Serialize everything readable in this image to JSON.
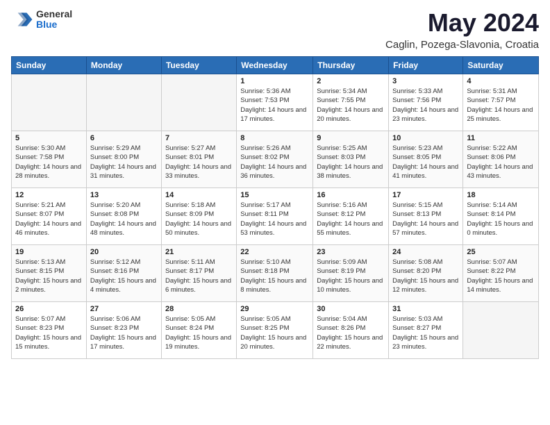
{
  "header": {
    "logo_general": "General",
    "logo_blue": "Blue",
    "title": "May 2024",
    "subtitle": "Caglin, Pozega-Slavonia, Croatia"
  },
  "weekdays": [
    "Sunday",
    "Monday",
    "Tuesday",
    "Wednesday",
    "Thursday",
    "Friday",
    "Saturday"
  ],
  "weeks": [
    [
      {
        "day": "",
        "empty": true
      },
      {
        "day": "",
        "empty": true
      },
      {
        "day": "",
        "empty": true
      },
      {
        "day": "1",
        "sunrise": "5:36 AM",
        "sunset": "7:53 PM",
        "daylight": "14 hours and 17 minutes."
      },
      {
        "day": "2",
        "sunrise": "5:34 AM",
        "sunset": "7:55 PM",
        "daylight": "14 hours and 20 minutes."
      },
      {
        "day": "3",
        "sunrise": "5:33 AM",
        "sunset": "7:56 PM",
        "daylight": "14 hours and 23 minutes."
      },
      {
        "day": "4",
        "sunrise": "5:31 AM",
        "sunset": "7:57 PM",
        "daylight": "14 hours and 25 minutes."
      }
    ],
    [
      {
        "day": "5",
        "sunrise": "5:30 AM",
        "sunset": "7:58 PM",
        "daylight": "14 hours and 28 minutes."
      },
      {
        "day": "6",
        "sunrise": "5:29 AM",
        "sunset": "8:00 PM",
        "daylight": "14 hours and 31 minutes."
      },
      {
        "day": "7",
        "sunrise": "5:27 AM",
        "sunset": "8:01 PM",
        "daylight": "14 hours and 33 minutes."
      },
      {
        "day": "8",
        "sunrise": "5:26 AM",
        "sunset": "8:02 PM",
        "daylight": "14 hours and 36 minutes."
      },
      {
        "day": "9",
        "sunrise": "5:25 AM",
        "sunset": "8:03 PM",
        "daylight": "14 hours and 38 minutes."
      },
      {
        "day": "10",
        "sunrise": "5:23 AM",
        "sunset": "8:05 PM",
        "daylight": "14 hours and 41 minutes."
      },
      {
        "day": "11",
        "sunrise": "5:22 AM",
        "sunset": "8:06 PM",
        "daylight": "14 hours and 43 minutes."
      }
    ],
    [
      {
        "day": "12",
        "sunrise": "5:21 AM",
        "sunset": "8:07 PM",
        "daylight": "14 hours and 46 minutes."
      },
      {
        "day": "13",
        "sunrise": "5:20 AM",
        "sunset": "8:08 PM",
        "daylight": "14 hours and 48 minutes."
      },
      {
        "day": "14",
        "sunrise": "5:18 AM",
        "sunset": "8:09 PM",
        "daylight": "14 hours and 50 minutes."
      },
      {
        "day": "15",
        "sunrise": "5:17 AM",
        "sunset": "8:11 PM",
        "daylight": "14 hours and 53 minutes."
      },
      {
        "day": "16",
        "sunrise": "5:16 AM",
        "sunset": "8:12 PM",
        "daylight": "14 hours and 55 minutes."
      },
      {
        "day": "17",
        "sunrise": "5:15 AM",
        "sunset": "8:13 PM",
        "daylight": "14 hours and 57 minutes."
      },
      {
        "day": "18",
        "sunrise": "5:14 AM",
        "sunset": "8:14 PM",
        "daylight": "15 hours and 0 minutes."
      }
    ],
    [
      {
        "day": "19",
        "sunrise": "5:13 AM",
        "sunset": "8:15 PM",
        "daylight": "15 hours and 2 minutes."
      },
      {
        "day": "20",
        "sunrise": "5:12 AM",
        "sunset": "8:16 PM",
        "daylight": "15 hours and 4 minutes."
      },
      {
        "day": "21",
        "sunrise": "5:11 AM",
        "sunset": "8:17 PM",
        "daylight": "15 hours and 6 minutes."
      },
      {
        "day": "22",
        "sunrise": "5:10 AM",
        "sunset": "8:18 PM",
        "daylight": "15 hours and 8 minutes."
      },
      {
        "day": "23",
        "sunrise": "5:09 AM",
        "sunset": "8:19 PM",
        "daylight": "15 hours and 10 minutes."
      },
      {
        "day": "24",
        "sunrise": "5:08 AM",
        "sunset": "8:20 PM",
        "daylight": "15 hours and 12 minutes."
      },
      {
        "day": "25",
        "sunrise": "5:07 AM",
        "sunset": "8:22 PM",
        "daylight": "15 hours and 14 minutes."
      }
    ],
    [
      {
        "day": "26",
        "sunrise": "5:07 AM",
        "sunset": "8:23 PM",
        "daylight": "15 hours and 15 minutes."
      },
      {
        "day": "27",
        "sunrise": "5:06 AM",
        "sunset": "8:23 PM",
        "daylight": "15 hours and 17 minutes."
      },
      {
        "day": "28",
        "sunrise": "5:05 AM",
        "sunset": "8:24 PM",
        "daylight": "15 hours and 19 minutes."
      },
      {
        "day": "29",
        "sunrise": "5:05 AM",
        "sunset": "8:25 PM",
        "daylight": "15 hours and 20 minutes."
      },
      {
        "day": "30",
        "sunrise": "5:04 AM",
        "sunset": "8:26 PM",
        "daylight": "15 hours and 22 minutes."
      },
      {
        "day": "31",
        "sunrise": "5:03 AM",
        "sunset": "8:27 PM",
        "daylight": "15 hours and 23 minutes."
      },
      {
        "day": "",
        "empty": true
      }
    ]
  ]
}
